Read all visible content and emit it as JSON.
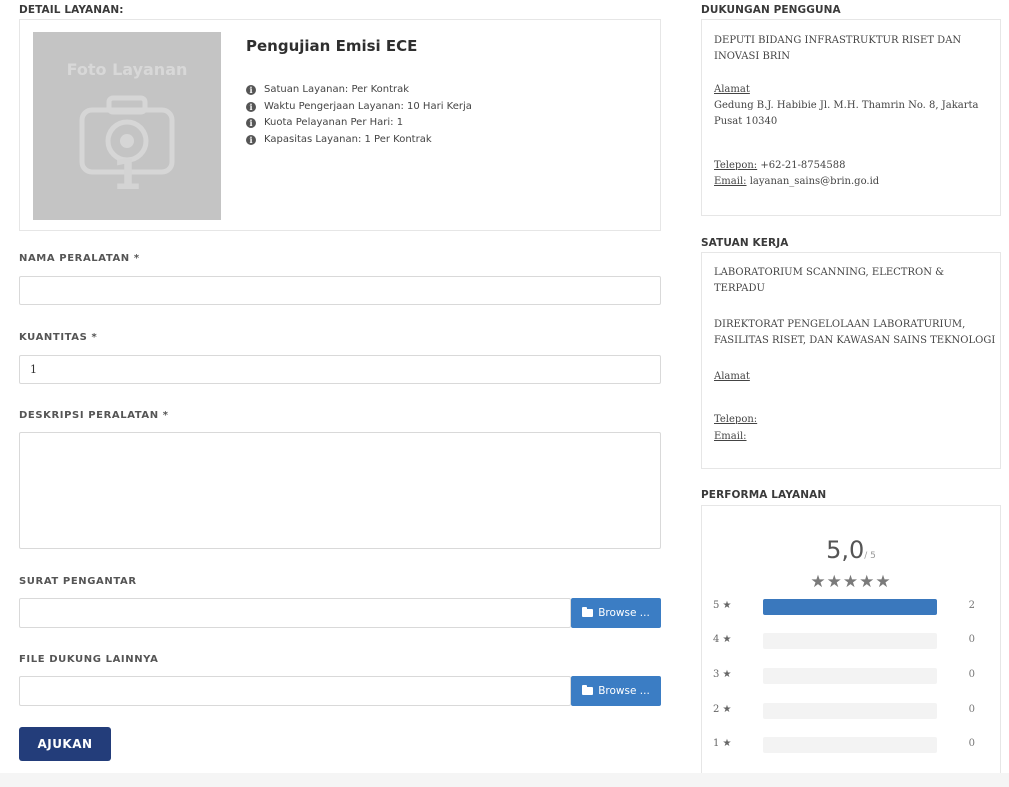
{
  "detail": {
    "section_title": "DETAIL LAYANAN:",
    "photo_text": "Foto Layanan",
    "photo_number": "1",
    "service_name": "Pengujian Emisi ECE",
    "specs": [
      "Satuan Layanan: Per Kontrak",
      "Waktu Pengerjaan Layanan: 10 Hari Kerja",
      "Kuota Pelayanan Per Hari: 1",
      "Kapasitas Layanan: 1 Per Kontrak"
    ]
  },
  "form": {
    "equipment_label": "NAMA PERALATAN *",
    "equipment_value": "",
    "quantity_label": "KUANTITAS *",
    "quantity_value": "1",
    "description_label": "DESKRIPSI PERALATAN *",
    "description_value": "",
    "cover_letter_label": "SURAT PENGANTAR",
    "other_files_label": "FILE DUKUNG LAINNYA",
    "browse_label": "Browse ...",
    "submit_label": "AJUKAN"
  },
  "support": {
    "section_title": "DUKUNGAN PENGGUNA",
    "org": "DEPUTI BIDANG INFRASTRUKTUR RISET DAN INOVASI BRIN",
    "address_label": "Alamat",
    "address": "Gedung B.J. Habibie Jl. M.H. Thamrin No. 8, Jakarta Pusat 10340",
    "phone_label": "Telepon:",
    "phone": " +62-21-8754588",
    "email_label": "Email:",
    "email": " layanan_sains@brin.go.id"
  },
  "unit": {
    "section_title": "SATUAN KERJA",
    "lab": "LABORATORIUM SCANNING, ELECTRON & TERPADU",
    "directorate": "DIREKTORAT PENGELOLAAN LABORATURIUM, FASILITAS RISET, DAN KAWASAN SAINS TEKNOLOGI",
    "address_label": "Alamat",
    "phone_label": "Telepon:",
    "email_label": "Email:"
  },
  "performance": {
    "section_title": "PERFORMA LAYANAN",
    "score": "5,0",
    "score_max": "/ 5",
    "stars": "★★★★★",
    "star_glyph": "★",
    "bar_color": "#3a78bd",
    "rows": [
      {
        "label": "5",
        "count": "2",
        "fraction": 1.0
      },
      {
        "label": "4",
        "count": "0",
        "fraction": 0
      },
      {
        "label": "3",
        "count": "0",
        "fraction": 0
      },
      {
        "label": "2",
        "count": "0",
        "fraction": 0
      },
      {
        "label": "1",
        "count": "0",
        "fraction": 0
      }
    ]
  }
}
